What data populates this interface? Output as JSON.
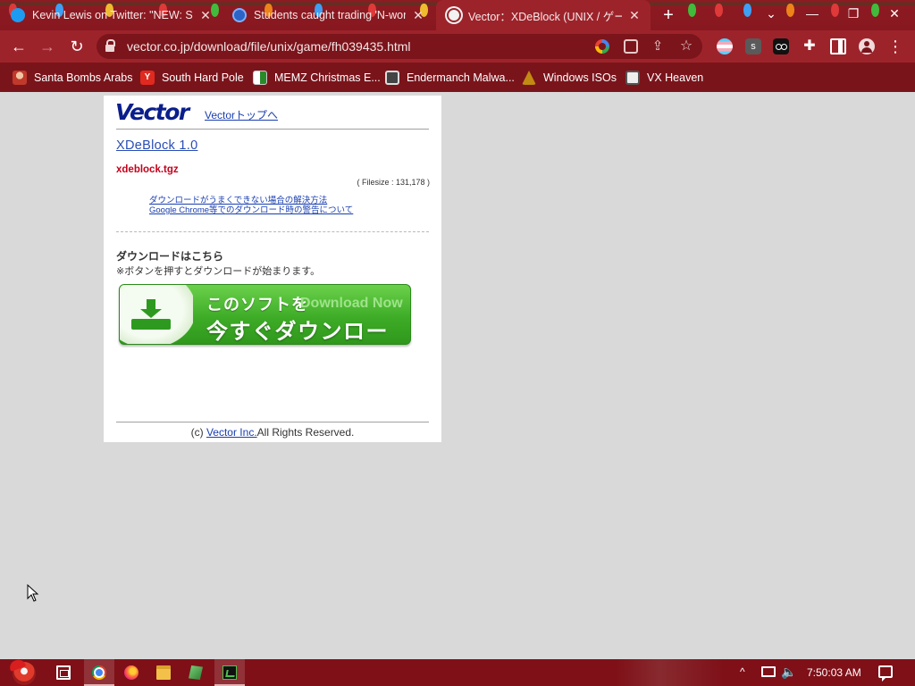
{
  "browser": {
    "tabs": [
      {
        "title": "Kevin Lewis on Twitter: \"NEW: St",
        "icon": "twitter-icon",
        "active": false
      },
      {
        "title": "Students caught trading 'N-word'",
        "icon": "ie-icon",
        "active": false
      },
      {
        "title": "Vector：XDeBlock (UNIX / ゲーム)",
        "icon": "globe-icon",
        "active": true
      }
    ],
    "new_tab_label": "+",
    "window_controls": {
      "tab_search": "⌄",
      "minimize": "—",
      "restore": "❐",
      "close": "✕"
    },
    "nav": {
      "back": "←",
      "forward": "→",
      "reload": "↻"
    },
    "url": "vector.co.jp/download/file/unix/game/fh039435.html",
    "extension_s_label": "s",
    "bookmarks": [
      {
        "label": "Santa Bombs Arabs",
        "icon": "santa-icon"
      },
      {
        "label": "South Hard Pole",
        "icon": "yandex-icon",
        "glyph": "Y"
      },
      {
        "label": "MEMZ Christmas E...",
        "icon": "memz-icon"
      },
      {
        "label": "Endermanch Malwa...",
        "icon": "endermanch-icon"
      },
      {
        "label": "Windows ISOs",
        "icon": "windows-isos-icon"
      },
      {
        "label": "VX Heaven",
        "icon": "vx-heaven-icon"
      }
    ]
  },
  "page": {
    "logo_text": "Vector",
    "top_link": "Vectorトップへ",
    "software_title": "XDeBlock 1.0",
    "file_name": "xdeblock.tgz",
    "file_size": "( Filesize : 131,178 )",
    "help_links": [
      "ダウンロードがうまくできない場合の解決方法",
      "Google Chrome等でのダウンロード時の警告について"
    ],
    "download_heading": "ダウンロードはこちら",
    "download_note": "※ボタンを押すとダウンロードが始まります。",
    "download_button": {
      "line1": "このソフトを",
      "line1_en": "Download Now",
      "line2": "今すぐダウンロード"
    },
    "footer_prefix": "(c)",
    "footer_link": "Vector Inc.",
    "footer_suffix": "All Rights Reserved."
  },
  "taskbar": {
    "clock": "7:50:03 AM",
    "tray_chevron": "^",
    "volume_glyph": "🔈",
    "apps": [
      "task-view",
      "chrome",
      "firefox",
      "file-explorer",
      "minecraft",
      "terminal"
    ]
  },
  "colors": {
    "chrome_frame": "#8e1a22",
    "toolbar": "#9d232b",
    "bookmarks_bar": "#7a141b",
    "page_bg": "#d9d9d9",
    "link": "#1a3fb0",
    "filename_red": "#c4001a",
    "download_green": "#3eac27"
  }
}
